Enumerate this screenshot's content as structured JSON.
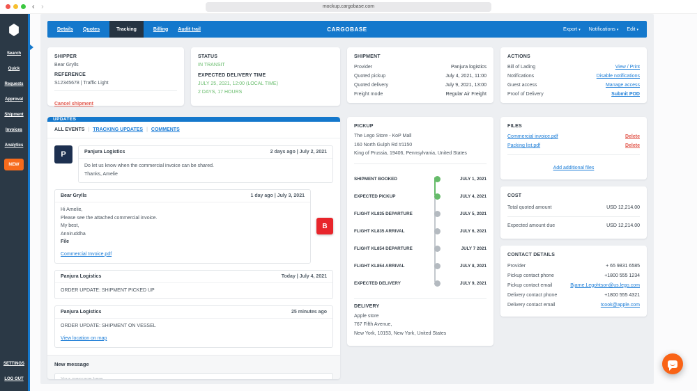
{
  "browser": {
    "url": "mockup.cargobase.com"
  },
  "sidebar": {
    "items": [
      "Search",
      "Quick",
      "Requests",
      "Approval",
      "Shipment",
      "Invoices",
      "Analytics"
    ],
    "new_button": "NEW",
    "settings": "SETTINGS",
    "logout": "LOG OUT"
  },
  "navbar": {
    "tabs": [
      "Details",
      "Quotes",
      "Tracking",
      "Billing",
      "Audit trail"
    ],
    "brand": "CARGOBASE",
    "menus": [
      "Export",
      "Notifications",
      "Edit"
    ]
  },
  "shipper_card": {
    "title": "SHIPPER",
    "name": "Bear Grylls",
    "reference_label": "REFERENCE",
    "reference": "S12345678 | Traffic Light",
    "cancel_link": "Cancel shipment"
  },
  "status_card": {
    "title": "STATUS",
    "status": "IN TRANSIT",
    "edt_label": "EXPECTED DELIVERY TIME",
    "edt": "JULY 25, 2021, 12:00 (LOCAL TIME)",
    "remaining": "2 DAYS, 17 HOURS"
  },
  "shipment_card": {
    "title": "SHIPMENT",
    "rows": [
      {
        "label": "Provider",
        "value": "Panjura logistics"
      },
      {
        "label": "Quoted pickup",
        "value": "July 4, 2021, 11:00"
      },
      {
        "label": "Quoted delivery",
        "value": "July 9, 2021, 13:00"
      },
      {
        "label": "Freight mode",
        "value": "Regular Air Freight"
      }
    ]
  },
  "actions_card": {
    "title": "ACTIONS",
    "rows": [
      {
        "label": "Bill of Lading",
        "link": "View / Print"
      },
      {
        "label": "Notifications",
        "link": "Disable notifications"
      },
      {
        "label": "Guest access",
        "link": "Manage access"
      },
      {
        "label": "Proof of Delivery",
        "link": "Submit POD"
      }
    ]
  },
  "updates": {
    "title": "UPDATES",
    "tabs": [
      "ALL EVENTS",
      "TRACKING UPDATES",
      "COMMENTS"
    ],
    "messages": [
      {
        "avatar": "P",
        "author": "Panjura Logistics",
        "time": "2 days ago | July 2, 2021",
        "lines": [
          "Do let us know when the commercial invoice can be shared.",
          "Thanks, Amelie"
        ]
      },
      {
        "avatar": "B",
        "author": "Bear Grylls",
        "time": "1 day ago | July 3, 2021",
        "lines": [
          "Hi Amelie,",
          "Please see the attached commercial invoice.",
          "My best,",
          "Anniruddha"
        ],
        "file_label": "File",
        "file_link": "Commercial Invoice.pdf"
      },
      {
        "author": "Panjura Logistics",
        "time": "Today | July 4, 2021",
        "lines": [
          "ORDER UPDATE: SHIPMENT PICKED UP"
        ]
      },
      {
        "author": "Panjura Logistics",
        "time": "25 minutes ago",
        "lines": [
          "ORDER UPDATE: SHIPMENT ON VESSEL"
        ],
        "map_link": "View location on map"
      }
    ],
    "composer": {
      "label": "New message",
      "placeholder": "Your message here..."
    }
  },
  "route_card": {
    "pickup_title": "PICKUP",
    "pickup_address": [
      "The Lego Store - KoP Mall",
      "160 North Gulph Rd #1150",
      "King of Prussia, 19406, Pennsylvania, United States"
    ],
    "timeline": [
      {
        "label": "SHIPMENT BOOKED",
        "date": "JULY 1, 2021",
        "done": true
      },
      {
        "label": "EXPECTED PICKUP",
        "date": "JULY 4, 2021",
        "done": true
      },
      {
        "label": "FLIGHT KL835 DEPARTURE",
        "date": "JULY 5, 2021",
        "done": false
      },
      {
        "label": "FLIGHT KL835 ARRIVAL",
        "date": "JULY 6, 2021",
        "done": false
      },
      {
        "label": "FLIGHT KL854 DEPARTURE",
        "date": "JULY 7 2021",
        "done": false
      },
      {
        "label": "FLIGHT KL854 ARRIVAL",
        "date": "JULY 8, 2021",
        "done": false
      },
      {
        "label": "EXPECTED DELIVERY",
        "date": "JULY 9, 2021",
        "done": false
      }
    ],
    "delivery_title": "DELIVERY",
    "delivery_address": [
      "Apple store",
      "767 Fifth Avenue,",
      "New York, 10153, New York, United States"
    ]
  },
  "files_card": {
    "title": "FILES",
    "files": [
      {
        "name": "Commercial invoice.pdf",
        "action": "Delete"
      },
      {
        "name": "Packing list.pdf",
        "action": "Delete"
      }
    ],
    "add_link": "Add additional files"
  },
  "cost_card": {
    "title": "COST",
    "rows": [
      {
        "label": "Total quoted amount",
        "value": "USD 12,214.00"
      },
      {
        "label": "Expected amount due",
        "value": "USD 12,214.00"
      }
    ]
  },
  "contact_card": {
    "title": "CONTACT DETAILS",
    "rows": [
      {
        "label": "Provider",
        "value": "+ 65 9831 6585"
      },
      {
        "label": "Pickup contact phone",
        "value": "+1800 555 1234"
      },
      {
        "label": "Pickup contact email",
        "value": "Bjarne.Legohtson@us.lego.com"
      },
      {
        "label": "Delivery contact phone",
        "value": "+1800 555 4321"
      },
      {
        "label": "Delivery contact email",
        "value": "tcook@apple.com"
      }
    ]
  },
  "colors": {
    "brand_blue": "#1478cc",
    "sidebar_navy": "#2b3946",
    "active_tab_navy": "#263442",
    "accent_orange": "#f76b1c",
    "status_green": "#66bb6a",
    "danger_red": "#e2574c",
    "link_blue": "#1a7cd7",
    "avatar_navy": "#1d3050",
    "avatar_red": "#e8252b",
    "chat_orange": "#f96316"
  }
}
